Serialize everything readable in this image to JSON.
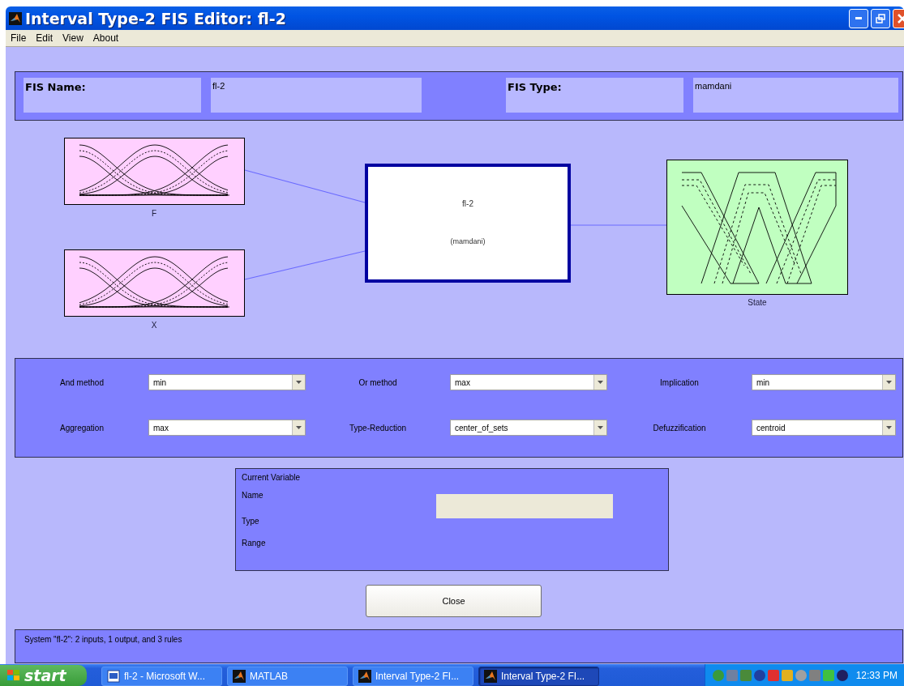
{
  "window": {
    "title": "Interval Type-2 FIS Editor: fl-2"
  },
  "menu": [
    "File",
    "Edit",
    "View",
    "About"
  ],
  "fis_header": {
    "name_label": "FIS Name:",
    "name_value": "fl-2",
    "type_label": "FIS Type:",
    "type_value": "mamdani"
  },
  "diagram": {
    "inputs": [
      {
        "name": "F"
      },
      {
        "name": "X"
      }
    ],
    "system": {
      "name": "fl-2",
      "type": "(mamdani)"
    },
    "outputs": [
      {
        "name": "State"
      }
    ]
  },
  "method_rows": [
    [
      {
        "label": "And method",
        "value": "min"
      },
      {
        "label": "Or method",
        "value": "max"
      },
      {
        "label": "Implication",
        "value": "min"
      }
    ],
    [
      {
        "label": "Aggregation",
        "value": "max"
      },
      {
        "label": "Type-Reduction",
        "value": "center_of_sets"
      },
      {
        "label": "Defuzzification",
        "value": "centroid"
      }
    ]
  ],
  "current_variable": {
    "title": "Current Variable",
    "fields": [
      "Name",
      "Type",
      "Range"
    ]
  },
  "close_button": "Close",
  "status": "System \"fl-2\": 2 inputs, 1 output, and 3 rules",
  "taskbar": {
    "start": "start",
    "tasks": [
      {
        "label": "fl-2 - Microsoft W...",
        "kind": "word",
        "selected": false
      },
      {
        "label": "MATLAB",
        "kind": "matlab",
        "selected": false
      },
      {
        "label": "Interval Type-2 FI...",
        "kind": "matlab",
        "selected": false
      },
      {
        "label": "Interval Type-2 FI...",
        "kind": "matlab",
        "selected": true
      }
    ],
    "clock": "12:33 PM"
  }
}
